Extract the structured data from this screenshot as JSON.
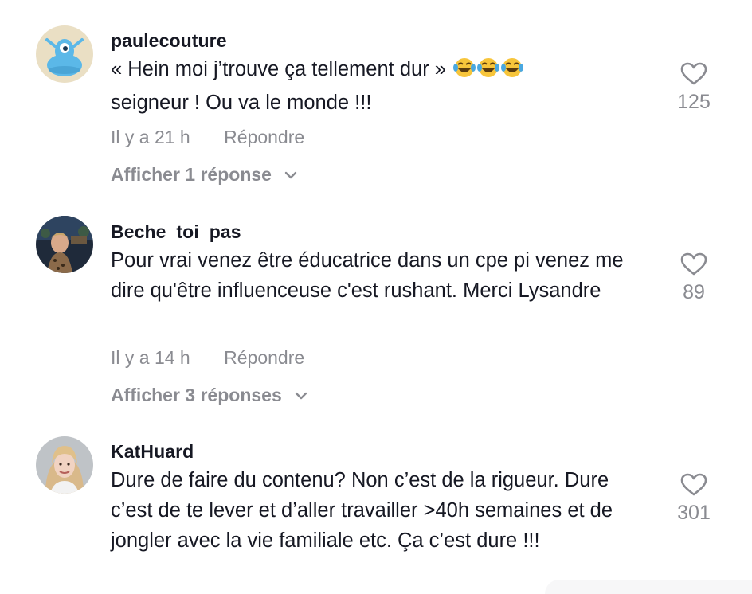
{
  "comments": [
    {
      "username": "paulecouture",
      "text": "« Hein moi j’trouve ça tellement dur »",
      "text_line2": "seigneur ! Ou va le monde !!!",
      "emojis": [
        "face-with-tears-of-joy-icon",
        "face-with-tears-of-joy-icon",
        "face-with-tears-of-joy-icon"
      ],
      "time": "Il y a 21 h",
      "reply_label": "Répondre",
      "view_replies": "Afficher 1 réponse",
      "likes": "125"
    },
    {
      "username": "Beche_toi_pas",
      "text": "Pour vrai venez être éducatrice dans un cpe pi venez me dire qu'être influenceuse c'est rushant. Merci Lysandre",
      "time": "Il y a 14 h",
      "reply_label": "Répondre",
      "view_replies": "Afficher 3 réponses",
      "likes": "89"
    },
    {
      "username": "KatHuard",
      "text": "Dure de faire du contenu? Non c’est de la rigueur. Dure c’est de te lever et d’aller travailler >40h semaines et de jongler avec la vie familiale etc. Ça c’est dure !!!",
      "likes": "301"
    }
  ],
  "colors": {
    "text": "#161823",
    "muted": "#8a8b91",
    "avatar1_bg": "#e9dcc0",
    "avatar1_figure": "#5bb8e8"
  },
  "icons": {
    "like": "heart-outline-icon",
    "expand": "chevron-down-icon"
  }
}
